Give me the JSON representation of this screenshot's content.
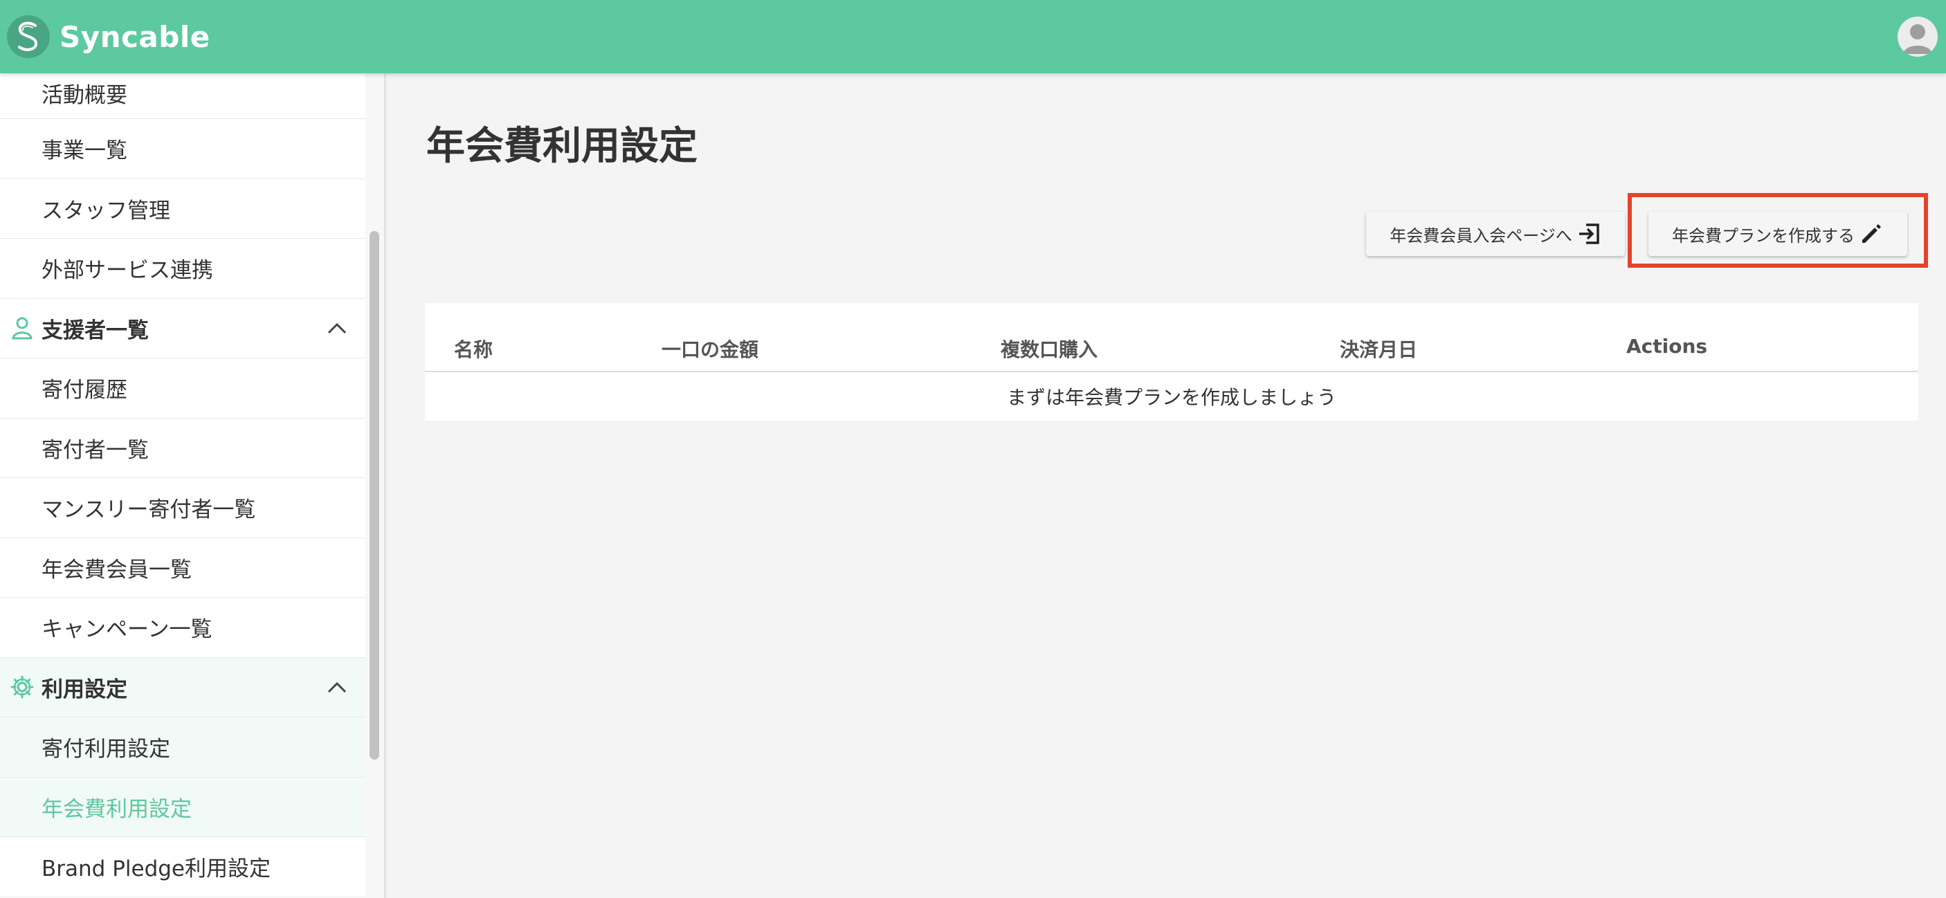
{
  "header": {
    "brand": "Syncable",
    "colors": {
      "primary": "#5cc9a0",
      "highlight": "#e5432b"
    }
  },
  "sidebar": {
    "items": [
      {
        "label": "活動概要",
        "type": "item"
      },
      {
        "label": "事業一覧",
        "type": "item"
      },
      {
        "label": "スタッフ管理",
        "type": "item"
      },
      {
        "label": "外部サービス連携",
        "type": "item"
      },
      {
        "label": "支援者一覧",
        "type": "section",
        "icon": "person-icon",
        "expanded": true
      },
      {
        "label": "寄付履歴",
        "type": "item"
      },
      {
        "label": "寄付者一覧",
        "type": "item"
      },
      {
        "label": "マンスリー寄付者一覧",
        "type": "item"
      },
      {
        "label": "年会費会員一覧",
        "type": "item"
      },
      {
        "label": "キャンペーン一覧",
        "type": "item"
      },
      {
        "label": "利用設定",
        "type": "section",
        "icon": "gear-icon",
        "expanded": true
      },
      {
        "label": "寄付利用設定",
        "type": "item"
      },
      {
        "label": "年会費利用設定",
        "type": "item",
        "active": true
      },
      {
        "label": "Brand Pledge利用設定",
        "type": "item"
      }
    ]
  },
  "main": {
    "title": "年会費利用設定",
    "buttons": {
      "entry_page": "年会費会員入会ページへ",
      "create_plan": "年会費プランを作成する"
    },
    "table": {
      "columns": [
        "名称",
        "一口の金額",
        "複数口購入",
        "決済月日",
        "Actions"
      ],
      "empty_message": "まずは年会費プランを作成しましょう"
    }
  }
}
